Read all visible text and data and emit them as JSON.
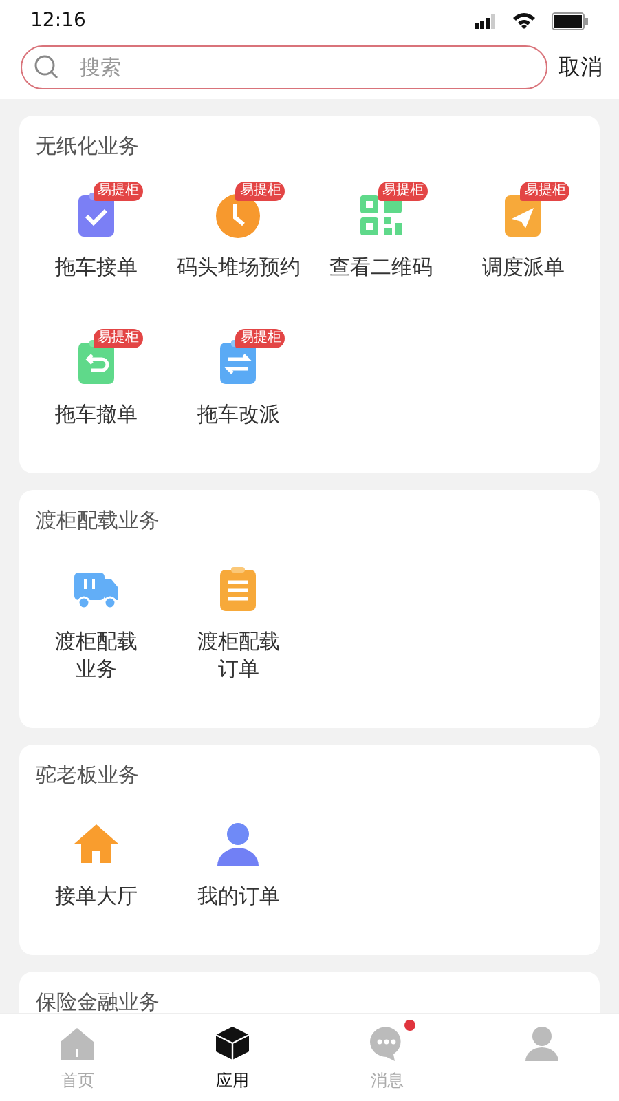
{
  "status_bar": {
    "time": "12:16"
  },
  "search": {
    "placeholder": "搜索",
    "cancel": "取消"
  },
  "sections": [
    {
      "title": "无纸化业务",
      "items": [
        {
          "label": "拖车接单",
          "kind": "clipboard-check",
          "badge": "易提柜"
        },
        {
          "label": "码头堆场预约",
          "kind": "clock",
          "badge": "易提柜"
        },
        {
          "label": "查看二维码",
          "kind": "qr",
          "badge": "易提柜"
        },
        {
          "label": "调度派单",
          "kind": "send",
          "badge": "易提柜"
        },
        {
          "label": "拖车撤单",
          "kind": "undo",
          "badge": "易提柜"
        },
        {
          "label": "拖车改派",
          "kind": "swap",
          "badge": "易提柜"
        }
      ]
    },
    {
      "title": "渡柜配载业务",
      "items": [
        {
          "label": "渡柜配载业务",
          "kind": "truck"
        },
        {
          "label": "渡柜配载订单",
          "kind": "list"
        }
      ]
    },
    {
      "title": "驼老板业务",
      "items": [
        {
          "label": "接单大厅",
          "kind": "house"
        },
        {
          "label": "我的订单",
          "kind": "person"
        }
      ]
    },
    {
      "title": "保险金融业务"
    }
  ],
  "tabs": [
    {
      "label": "首页",
      "kind": "home",
      "selected": false,
      "dot": false
    },
    {
      "label": "应用",
      "kind": "cube",
      "selected": true,
      "dot": false
    },
    {
      "label": "消息",
      "kind": "chat",
      "selected": false,
      "dot": true
    },
    {
      "kind": "user",
      "selected": false,
      "dot": false
    }
  ]
}
